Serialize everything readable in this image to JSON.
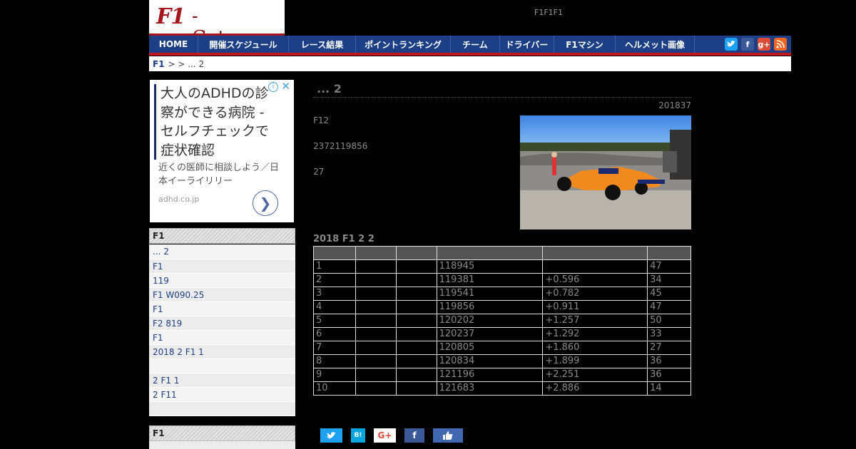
{
  "logo": {
    "part1": "F1",
    "part2": "-Gate.com"
  },
  "header": {
    "tagline": "F1F1F1"
  },
  "nav": {
    "items": [
      "HOME",
      "開催スケジュール",
      "レース結果",
      "ポイントランキング",
      "チーム",
      "ドライバー",
      "F1マシン",
      "ヘルメット画像"
    ],
    "social": [
      "twitter-icon",
      "facebook-icon",
      "google-plus-icon",
      "rss-icon"
    ]
  },
  "breadcrumb": {
    "root": "F1",
    "rest": "> > ... 2"
  },
  "ad": {
    "headline": "大人のADHDの診察ができる病院 - セルフチェックで症状確認",
    "description": "近くの医師に相談しよう／日本イーライリリー",
    "domain": "adhd.co.jp",
    "info": "i",
    "close": "✕",
    "arrow": "❯"
  },
  "sidebar": {
    "head1": "F1",
    "items1": [
      "... 2",
      "F1",
      "119",
      "F1 W090.25",
      " F1",
      "F2 819",
      "F1",
      "2018 2 F1 1",
      "",
      "2 F1 1",
      " 2 F11",
      ""
    ],
    "head2": "F1"
  },
  "article": {
    "title": "... 2",
    "date": "201837",
    "para1": "F12",
    "para2": "2372119856",
    "para3": "27",
    "table_title": "2018 F1 2 2",
    "table_rows": [
      {
        "pos": "1",
        "time": "118945",
        "gap": "",
        "laps": "47"
      },
      {
        "pos": "2",
        "time": "119381",
        "gap": "+0.596",
        "laps": "34"
      },
      {
        "pos": "3",
        "time": "119541",
        "gap": "+0.782",
        "laps": "45"
      },
      {
        "pos": "4",
        "time": "119856",
        "gap": "+0.911",
        "laps": "47"
      },
      {
        "pos": "5",
        "time": "120202",
        "gap": "+1.257",
        "laps": "50"
      },
      {
        "pos": "6",
        "time": "120237",
        "gap": "+1.292",
        "laps": "33"
      },
      {
        "pos": "7",
        "time": "120805",
        "gap": "+1.860",
        "laps": "27"
      },
      {
        "pos": "8",
        "time": "120834",
        "gap": "+1.899",
        "laps": "36"
      },
      {
        "pos": "9",
        "time": "121196",
        "gap": "+2.251",
        "laps": "36"
      },
      {
        "pos": "10",
        "time": "121683",
        "gap": "+2.886",
        "laps": "14"
      }
    ]
  },
  "share": {
    "twitter": "twitter-icon",
    "hatena": "B!",
    "google": "G+",
    "facebook": "f",
    "like": "like-icon"
  },
  "colors": {
    "nav_bg": "#1c3f86",
    "nav_border": "#c4161c",
    "logo_red": "#a8161b"
  }
}
